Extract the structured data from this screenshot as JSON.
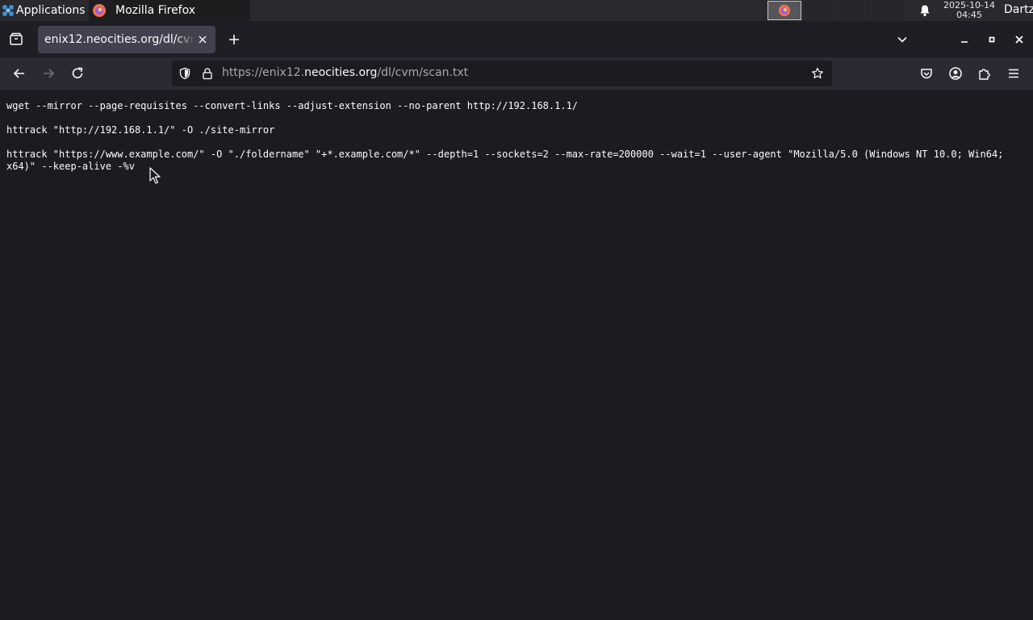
{
  "panel": {
    "applications_label": "Applications",
    "window_title": "Mozilla Firefox",
    "clock_date": "2025-10-14",
    "clock_time": "04:45",
    "user": "Dartz"
  },
  "tab": {
    "title": "enix12.neocities.org/dl/cvm/scan.txt"
  },
  "urlbar": {
    "scheme": "https://enix12.",
    "host": "neocities.org",
    "path": "/dl/cvm/scan.txt"
  },
  "content": {
    "lines": [
      "wget --mirror --page-requisites --convert-links --adjust-extension --no-parent http://192.168.1.1/",
      "",
      "httrack \"http://192.168.1.1/\" -O ./site-mirror",
      "",
      "httrack \"https://www.example.com/\" -O \"./foldername\" \"+*.example.com/*\" --depth=1 --sockets=2 --max-rate=200000 --wait=1 --user-agent \"Mozilla/5.0 (Windows NT 10.0; Win64; x64)\" --keep-alive -%v"
    ]
  },
  "colors": {
    "page_bg": "#1c1b22",
    "toolbar_bg": "#2b2a33",
    "tab_active": "#42414d",
    "text": "#fbfbfe"
  }
}
